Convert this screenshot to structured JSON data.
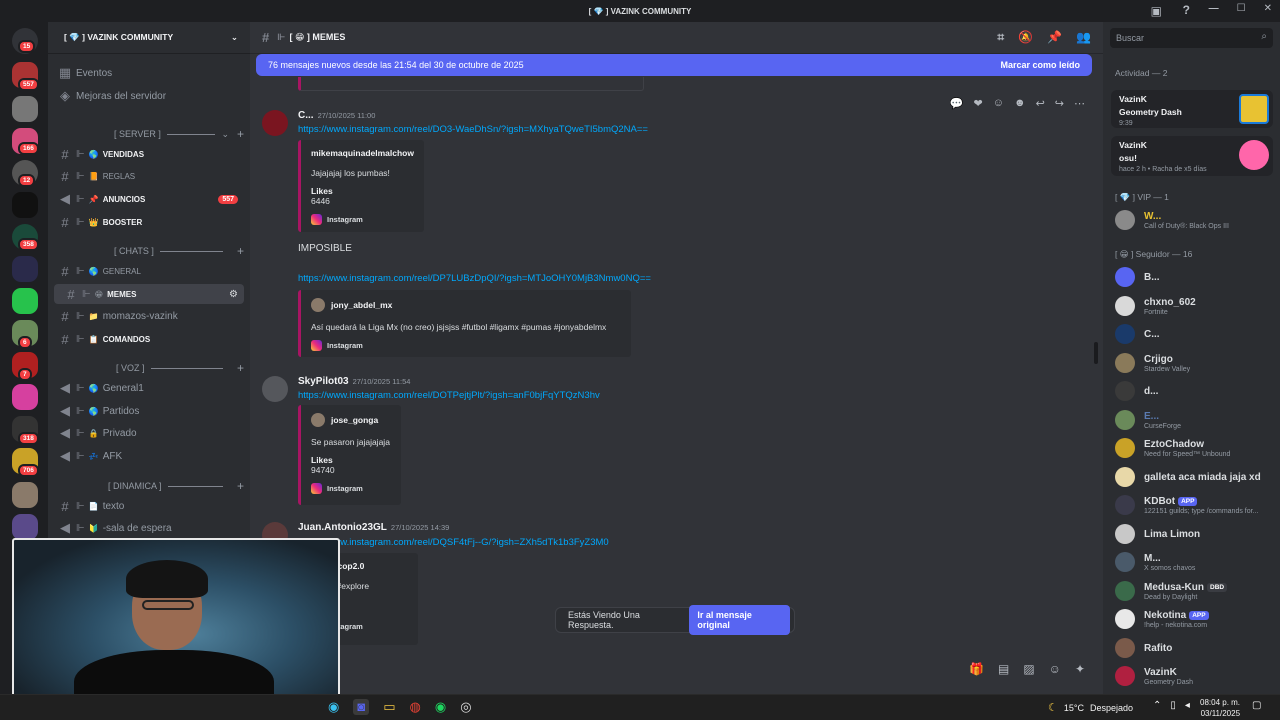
{
  "window": {
    "title": "[ 💎 ] VAZINK COMMUNITY"
  },
  "guild_rail": {
    "badges": [
      "15",
      "557",
      "166",
      "12",
      "358",
      "6",
      "7",
      "318",
      "706"
    ]
  },
  "sidebar": {
    "server_name": "[ 💎 ] VAZINK COMMUNITY",
    "top_items": [
      "Eventos",
      "Mejoras del servidor"
    ],
    "categories": [
      "[ SERVER ]",
      "[ CHATS ]",
      "[ VOZ ]",
      "[ DINAMICA ]"
    ],
    "channels": [
      {
        "name": "VENDIDAS",
        "emoji": "🌎"
      },
      {
        "name": "REGLAS",
        "emoji": "📙"
      },
      {
        "name": "ANUNCIOS",
        "emoji": "📌",
        "badge": "557"
      },
      {
        "name": "BOOSTER",
        "emoji": "👑"
      },
      {
        "name": "GENERAL",
        "emoji": "🌎"
      },
      {
        "name": "MEMES",
        "emoji": "😁"
      },
      {
        "name": "momazos-vazink",
        "emoji": "📁"
      },
      {
        "name": "COMANDOS",
        "emoji": "📋"
      },
      {
        "name": "General1",
        "emoji": "🌎"
      },
      {
        "name": "Partidos",
        "emoji": "🌎"
      },
      {
        "name": "Privado",
        "emoji": "🔒"
      },
      {
        "name": "AFK",
        "emoji": "💤"
      },
      {
        "name": "texto",
        "emoji": "📄"
      },
      {
        "name": "-sala de espera",
        "emoji": "🔰"
      }
    ]
  },
  "main": {
    "channel_title": "[ 😁 ] MEMES",
    "new_messages_text": "76 mensajes nuevos desde las 21:54 del 30 de octubre de 2025",
    "mark_read_label": "Marcar como leído",
    "messages": [
      {
        "author": "C...",
        "timestamp": "27/10/2025 11:00",
        "link": "https://www.instagram.com/reel/DO3-WaeDhSn/?igsh=MXhyaTQweTI5bmQ2NA==",
        "embed": {
          "author": "mikemaquinadelmalchow",
          "text": "Jajajajaj los pumbas!",
          "likes_label": "Likes",
          "likes": "6446",
          "footer": "Instagram"
        }
      },
      {
        "text": "IMPOSIBLE",
        "link": "https://www.instagram.com/reel/DP7LUBzDpQI/?igsh=MTJoOHY0MjB3Nmw0NQ==",
        "embed": {
          "author": "jony_abdel_mx",
          "text": "Así quedará la Liga Mx (no creo) jsjsjss #futbol #ligamx #pumas #jonyabdelmx",
          "footer": "Instagram"
        }
      },
      {
        "author": "SkyPilot03",
        "timestamp": "27/10/2025 11:54",
        "link": "https://www.instagram.com/reel/DOTPejtjPlt/?igsh=anF0bjFqYTQzN3hv",
        "embed": {
          "author": "jose_gonga",
          "text": "Se pasaron jajajajaja",
          "likes_label": "Likes",
          "likes": "94740",
          "footer": "Instagram"
        }
      },
      {
        "author": "Juan.Antonio23GL",
        "timestamp": "27/10/2025 14:39",
        "link": "https://www.instagram.com/reel/DQSF4tFj--G/?igsh=ZXh5dTk1b3FyZ3M0",
        "embed": {
          "author": "etexascop2.0",
          "text": "#reels #explore",
          "footer": "Instagram"
        }
      }
    ],
    "reply_notice": "Estás Viendo Una Respuesta.",
    "reply_button": "Ir al mensaje original"
  },
  "members": {
    "search_placeholder": "Buscar",
    "activity_header": "Actividad — 2",
    "activities": [
      {
        "name": "VazinK",
        "game": "Geometry Dash",
        "detail": "9:39"
      },
      {
        "name": "VazinK",
        "game": "osu!",
        "detail": "hace 2 h  •  Racha de x5 días"
      }
    ],
    "vip_header": "[ 💎 ] VIP — 1",
    "vip": [
      {
        "name": "W...",
        "status": "Call of Duty®: Black Ops III"
      }
    ],
    "follower_header": "[ 😁 ] Seguidor — 16",
    "followers": [
      {
        "name": "B...",
        "status": ""
      },
      {
        "name": "chxno_602",
        "status": "Fortnite"
      },
      {
        "name": "C...",
        "status": ""
      },
      {
        "name": "Crjigo",
        "status": "Stardew Valley"
      },
      {
        "name": "d...",
        "status": ""
      },
      {
        "name": "E...",
        "status": "CurseForge"
      },
      {
        "name": "EztoChadow",
        "status": "Need for Speed™ Unbound"
      },
      {
        "name": "galleta aca miada jaja xd",
        "status": ""
      },
      {
        "name": "KDBot",
        "tag": "APP",
        "status": "122151 guilds; type /commands for..."
      },
      {
        "name": "Lima Limon",
        "status": ""
      },
      {
        "name": "M...",
        "status": "X somos chavos"
      },
      {
        "name": "Medusa-Kun",
        "tag": "DBD",
        "status": "Dead by Daylight"
      },
      {
        "name": "Nekotina",
        "tag": "APP",
        "status": "!help - nekotina.com"
      },
      {
        "name": "Rafito",
        "status": ""
      },
      {
        "name": "VazinK",
        "status": "Geometry Dash"
      }
    ]
  },
  "taskbar": {
    "temperature": "15°C",
    "weather": "Despejado",
    "time": "08:04 p. m.",
    "date": "03/11/2025"
  },
  "colors": {
    "accent": "#5865f2",
    "link": "#00a8fc",
    "badge": "#f23f42",
    "embed_border": "#a81563"
  }
}
